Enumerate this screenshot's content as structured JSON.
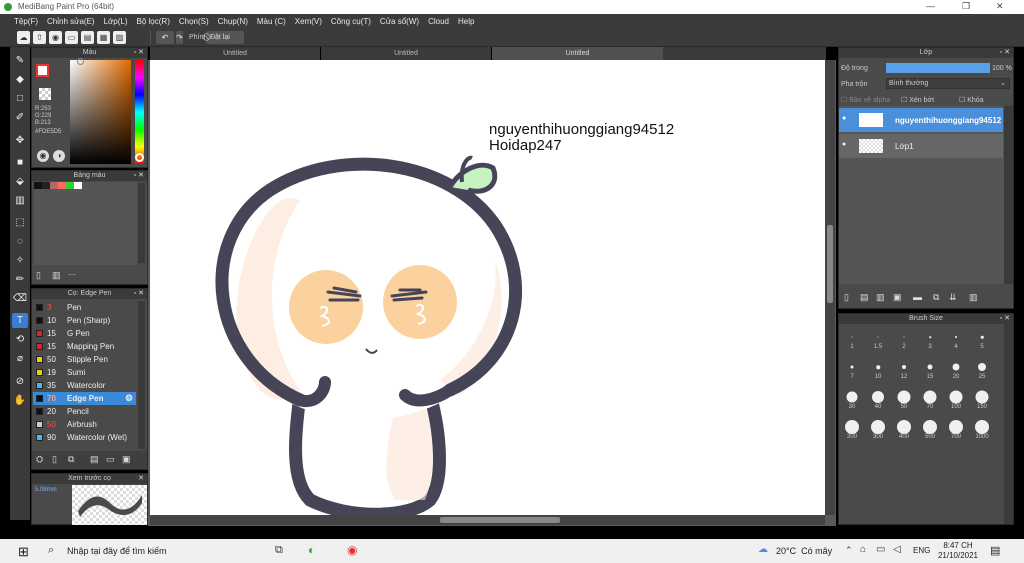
{
  "window": {
    "title": "MediBang Paint Pro (64bit)"
  },
  "menu": [
    "Tệp(F)",
    "Chỉnh sửa(E)",
    "Lớp(L)",
    "Bộ lọc(R)",
    "Chọn(S)",
    "Chụp(N)",
    "Màu (C)",
    "Xem(V)",
    "Công cụ(T)",
    "Cửa sổ(W)",
    "Cloud",
    "Help"
  ],
  "toolbar": {
    "key_label": "Phím",
    "reset_label": "Đặt lại"
  },
  "tabs": [
    "Untitled",
    "Untitled",
    "Untitled"
  ],
  "color_panel": {
    "title": "Màu",
    "r": "R:253",
    "g": "G:229",
    "b": "B:213",
    "hex": "#FDE5D5",
    "primary": "#ffffff",
    "accent": "#fde5d5"
  },
  "palette_panel": {
    "title": "Bảng màu",
    "swatches": [
      "#111111",
      "#222222",
      "#b06a6a",
      "#ff6666",
      "#33cc33",
      "#ffffff"
    ]
  },
  "brush_panel": {
    "title": "Cọ: Edge Pen",
    "brushes": [
      {
        "size": "3",
        "name": "Pen",
        "color": "#111111"
      },
      {
        "size": "10",
        "name": "Pen (Sharp)",
        "color": "#111111"
      },
      {
        "size": "15",
        "name": "G Pen",
        "color": "#dd2222"
      },
      {
        "size": "15",
        "name": "Mapping Pen",
        "color": "#dd2222"
      },
      {
        "size": "50",
        "name": "Stipple Pen",
        "color": "#e8d000"
      },
      {
        "size": "19",
        "name": "Sumi",
        "color": "#e8d000"
      },
      {
        "size": "35",
        "name": "Watercolor",
        "color": "#44bbee"
      },
      {
        "size": "70",
        "name": "Edge Pen",
        "color": "#111111"
      },
      {
        "size": "20",
        "name": "Pencil",
        "color": "#111111"
      },
      {
        "size": "50",
        "name": "Airbrush",
        "color": "#cccccc"
      },
      {
        "size": "90",
        "name": "Watercolor (Wet)",
        "color": "#44bbee"
      }
    ]
  },
  "preview_panel": {
    "title": "Xem trước cọ",
    "size": "5.08mm"
  },
  "canvas_text": {
    "line1": "nguyenthihuonggiang94512",
    "line2": "Hoidap247"
  },
  "layer_panel": {
    "title": "Lớp",
    "opacity_label": "Độ trong",
    "opacity_value": "100 %",
    "blend_label": "Pha trộn",
    "blend_value": "Bình thường",
    "protect_alpha": "Bảo vệ alpha",
    "clipping": "Xén bớt",
    "lock": "Khóa",
    "layers": [
      "nguyenthihuonggiang94512",
      "Lớp1"
    ]
  },
  "brush_size_panel": {
    "title": "Brush Size",
    "sizes": [
      "1",
      "1.5",
      "2",
      "3",
      "4",
      "5",
      "7",
      "10",
      "12",
      "15",
      "20",
      "25",
      "30",
      "40",
      "50",
      "70",
      "100",
      "150",
      "200",
      "300",
      "400",
      "500",
      "700",
      "1000"
    ]
  },
  "taskbar": {
    "search_placeholder": "Nhập tại đây để tìm kiếm",
    "weather": "20°C  Có mây",
    "language": "ENG",
    "time": "8:47 CH",
    "date": "21/10/2021"
  }
}
